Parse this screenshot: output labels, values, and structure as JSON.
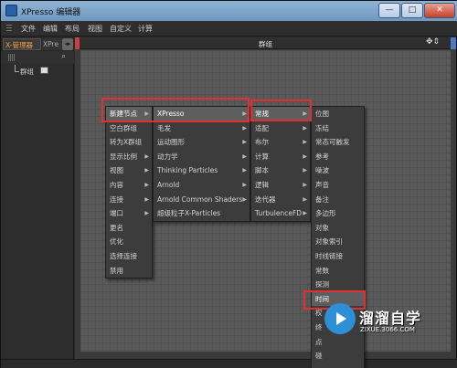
{
  "window": {
    "title": "XPresso 编辑器",
    "min": "—",
    "max": "□",
    "close": "✕"
  },
  "menubar": [
    "文件",
    "编辑",
    "布局",
    "视图",
    "自定义",
    "计算"
  ],
  "left_panel": {
    "tab_active": "X-管理器",
    "tab_2": "XPre",
    "tab_arrows": "◂▸",
    "search_glyph": "⌕",
    "tree_item": "群组"
  },
  "editor": {
    "title": "群组",
    "nav_glyph": "✥⇕"
  },
  "menu1": [
    "新建节点",
    "空白群组",
    "转为X群组",
    "显示比例",
    "视图",
    "内容",
    "连接",
    "端口",
    "更名",
    "优化",
    "选择连接",
    "禁用"
  ],
  "menu1_submenu_flags": [
    true,
    false,
    false,
    true,
    true,
    true,
    true,
    true,
    false,
    false,
    false,
    false
  ],
  "menu2": [
    "XPresso",
    "毛发",
    "运动图形",
    "动力学",
    "Thinking Particles",
    "Arnold",
    "Arnold Common Shaders",
    "超级粒子X-Particles"
  ],
  "menu3": [
    "常规",
    "适配",
    "布尔",
    "计算",
    "脚本",
    "逻辑",
    "迭代器",
    "TurbulenceFD"
  ],
  "menu4": [
    "位图",
    "冻结",
    "常态可触发",
    "参考",
    "噪波",
    "声音",
    "备注",
    "多边形",
    "对象",
    "对象索引",
    "时线链接",
    "常数",
    "探测",
    "时间",
    "权",
    "终",
    "点",
    "碰"
  ],
  "colors": {
    "highlight_box": "#e03030",
    "tab_active_text": "#f0a040",
    "watermark": "#2d8fd6"
  },
  "watermark": {
    "brand": "溜溜自学",
    "url": "ZIXUE.3066.COM"
  }
}
